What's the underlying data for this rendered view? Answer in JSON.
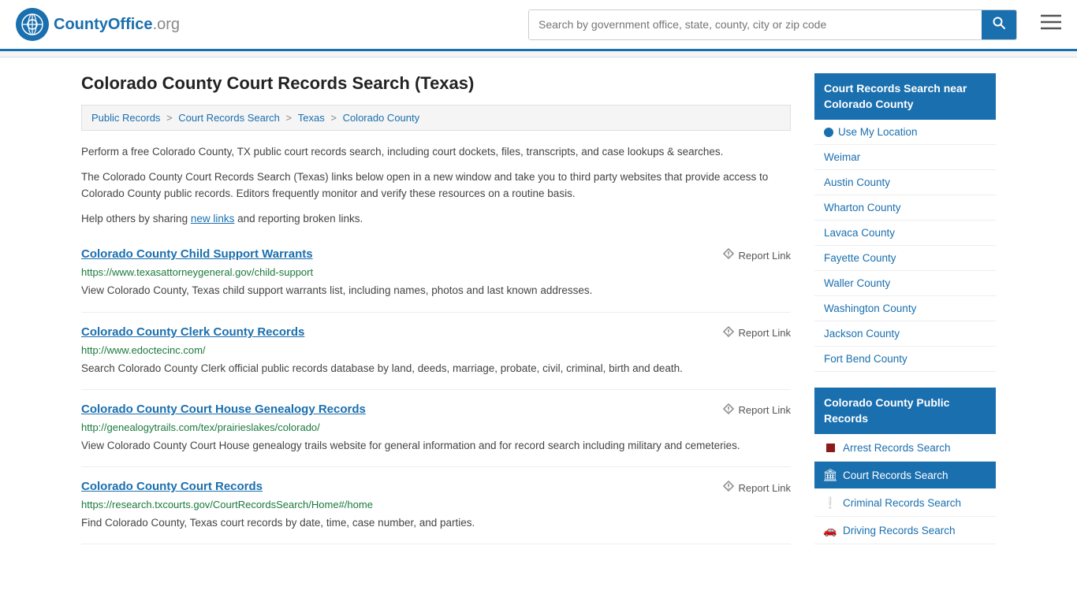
{
  "header": {
    "logo_text": "CountyOffice",
    "logo_org": ".org",
    "search_placeholder": "Search by government office, state, county, city or zip code"
  },
  "page": {
    "title": "Colorado County Court Records Search (Texas)",
    "breadcrumb": [
      {
        "label": "Public Records",
        "href": "#"
      },
      {
        "label": "Court Records Search",
        "href": "#"
      },
      {
        "label": "Texas",
        "href": "#"
      },
      {
        "label": "Colorado County",
        "href": "#"
      }
    ],
    "intro1": "Perform a free Colorado County, TX public court records search, including court dockets, files, transcripts, and case lookups & searches.",
    "intro2": "The Colorado County Court Records Search (Texas) links below open in a new window and take you to third party websites that provide access to Colorado County public records. Editors frequently monitor and verify these resources on a routine basis.",
    "intro3_prefix": "Help others by sharing ",
    "intro3_link": "new links",
    "intro3_suffix": " and reporting broken links."
  },
  "records": [
    {
      "title": "Colorado County Child Support Warrants",
      "url": "https://www.texasattorneygeneral.gov/child-support",
      "desc": "View Colorado County, Texas child support warrants list, including names, photos and last known addresses.",
      "report": "Report Link"
    },
    {
      "title": "Colorado County Clerk County Records",
      "url": "http://www.edoctecinc.com/",
      "desc": "Search Colorado County Clerk official public records database by land, deeds, marriage, probate, civil, criminal, birth and death.",
      "report": "Report Link"
    },
    {
      "title": "Colorado County Court House Genealogy Records",
      "url": "http://genealogytrails.com/tex/prairieslakes/colorado/",
      "desc": "View Colorado County Court House genealogy trails website for general information and for record search including military and cemeteries.",
      "report": "Report Link"
    },
    {
      "title": "Colorado County Court Records",
      "url": "https://research.txcourts.gov/CourtRecordsSearch/Home#/home",
      "desc": "Find Colorado County, Texas court records by date, time, case number, and parties.",
      "report": "Report Link"
    }
  ],
  "sidebar": {
    "section1_header": "Court Records Search near Colorado County",
    "location_label": "Use My Location",
    "nearby_counties": [
      "Weimar",
      "Austin County",
      "Wharton County",
      "Lavaca County",
      "Fayette County",
      "Waller County",
      "Washington County",
      "Jackson County",
      "Fort Bend County"
    ],
    "section2_header": "Colorado County Public Records",
    "public_records": [
      {
        "label": "Arrest Records Search",
        "icon": "square",
        "active": false
      },
      {
        "label": "Court Records Search",
        "icon": "building",
        "active": true
      },
      {
        "label": "Criminal Records Search",
        "icon": "exclamation",
        "active": false
      },
      {
        "label": "Driving Records Search",
        "icon": "car",
        "active": false
      }
    ]
  }
}
